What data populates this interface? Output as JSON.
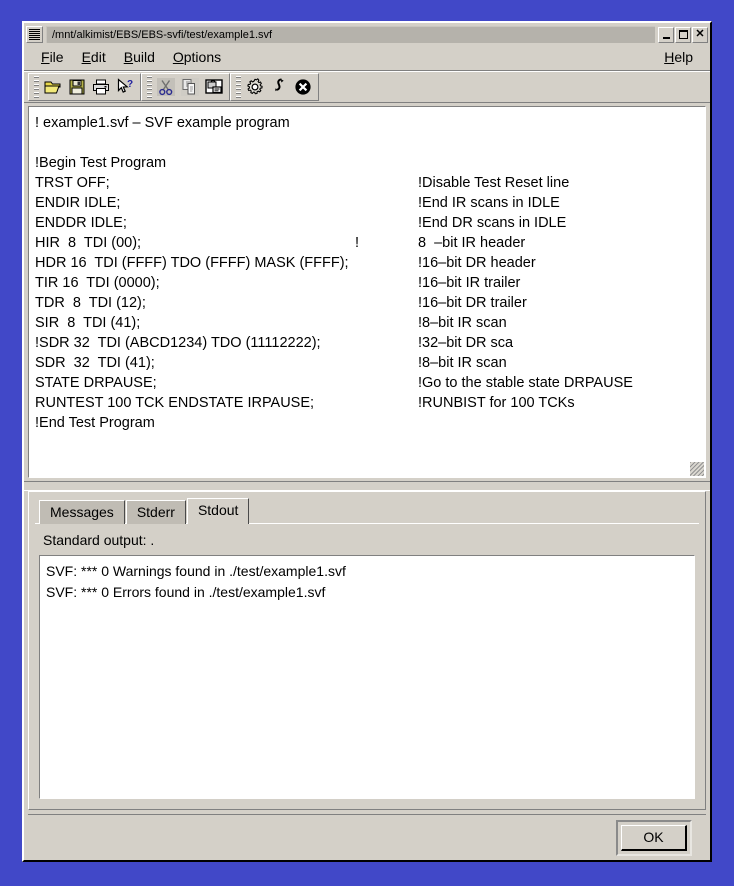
{
  "window": {
    "title": "/mnt/alkimist/EBS/EBS-svfi/test/example1.svf",
    "sysmenu_icon": "system-menu-icon",
    "buttons": {
      "minimize": "_",
      "maximize": "□",
      "close": "✕"
    }
  },
  "menubar": {
    "items": [
      {
        "label": "File",
        "mnemonic": "F"
      },
      {
        "label": "Edit",
        "mnemonic": "E"
      },
      {
        "label": "Build",
        "mnemonic": "B"
      },
      {
        "label": "Options",
        "mnemonic": "O"
      }
    ],
    "help": {
      "label": "Help",
      "mnemonic": "H"
    }
  },
  "toolbar": {
    "groups": [
      {
        "name": "file-group",
        "buttons": [
          {
            "icon": "open-folder-icon",
            "label": "Open",
            "enabled": true
          },
          {
            "icon": "save-floppy-icon",
            "label": "Save",
            "enabled": true
          },
          {
            "icon": "printer-icon",
            "label": "Print",
            "enabled": true
          },
          {
            "icon": "help-pointer-icon",
            "label": "Context Help",
            "enabled": true
          }
        ]
      },
      {
        "name": "edit-group",
        "buttons": [
          {
            "icon": "cut-scissors-icon",
            "label": "Cut",
            "enabled": false
          },
          {
            "icon": "copy-pages-icon",
            "label": "Copy",
            "enabled": false
          },
          {
            "icon": "paste-clipboard-icon",
            "label": "Paste",
            "enabled": true
          }
        ]
      },
      {
        "name": "build-group",
        "buttons": [
          {
            "icon": "gear-icon",
            "label": "Build",
            "enabled": true
          },
          {
            "icon": "hook-run-icon",
            "label": "Run",
            "enabled": true
          },
          {
            "icon": "stop-circle-icon",
            "label": "Stop",
            "enabled": true
          }
        ]
      }
    ]
  },
  "editor": {
    "lines": [
      {
        "code": "! example1.svf – SVF example program",
        "mark": "",
        "comment": ""
      },
      {
        "code": "",
        "mark": "",
        "comment": ""
      },
      {
        "code": "!Begin Test Program",
        "mark": "",
        "comment": ""
      },
      {
        "code": "TRST OFF;",
        "mark": "",
        "comment": "!Disable Test Reset line"
      },
      {
        "code": "ENDIR IDLE;",
        "mark": "",
        "comment": "!End IR scans in IDLE"
      },
      {
        "code": "ENDDR IDLE;",
        "mark": "",
        "comment": "!End DR scans in IDLE"
      },
      {
        "code": "HIR  8  TDI (00);",
        "mark": "!",
        "comment": "8  –bit IR header"
      },
      {
        "code": "HDR 16  TDI (FFFF) TDO (FFFF) MASK (FFFF);",
        "mark": "",
        "comment": "!16–bit DR header"
      },
      {
        "code": "TIR 16  TDI (0000);",
        "mark": "",
        "comment": "!16–bit IR trailer"
      },
      {
        "code": "TDR  8  TDI (12);",
        "mark": "",
        "comment": "!16–bit DR trailer"
      },
      {
        "code": "SIR  8  TDI (41);",
        "mark": "",
        "comment": "!8–bit IR scan"
      },
      {
        "code": "!SDR 32  TDI (ABCD1234) TDO (11112222);",
        "mark": "",
        "comment": "!32–bit DR sca"
      },
      {
        "code": "SDR  32  TDI (41);",
        "mark": "",
        "comment": "!8–bit IR scan"
      },
      {
        "code": "STATE DRPAUSE;",
        "mark": "",
        "comment": "!Go to the stable state DRPAUSE"
      },
      {
        "code": "RUNTEST 100 TCK ENDSTATE IRPAUSE;",
        "mark": "",
        "comment": "!RUNBIST for 100 TCKs"
      },
      {
        "code": "!End Test Program",
        "mark": "",
        "comment": ""
      }
    ]
  },
  "output": {
    "tabs": [
      {
        "label": "Messages",
        "active": false
      },
      {
        "label": "Stderr",
        "active": false
      },
      {
        "label": "Stdout",
        "active": true
      }
    ],
    "standard_output_label": "Standard output: .",
    "lines": [
      "SVF: *** 0 Warnings found in ./test/example1.svf",
      "SVF: *** 0 Errors found in ./test/example1.svf"
    ]
  },
  "footer": {
    "ok_label": "OK"
  },
  "colors": {
    "desktop": "#4148c8",
    "face": "#d4d0c8",
    "shadow": "#808080",
    "light": "#ffffff",
    "text": "#000000",
    "titlebar_field": "#b5b2ab",
    "tab_inactive": "#c0bcb4"
  }
}
